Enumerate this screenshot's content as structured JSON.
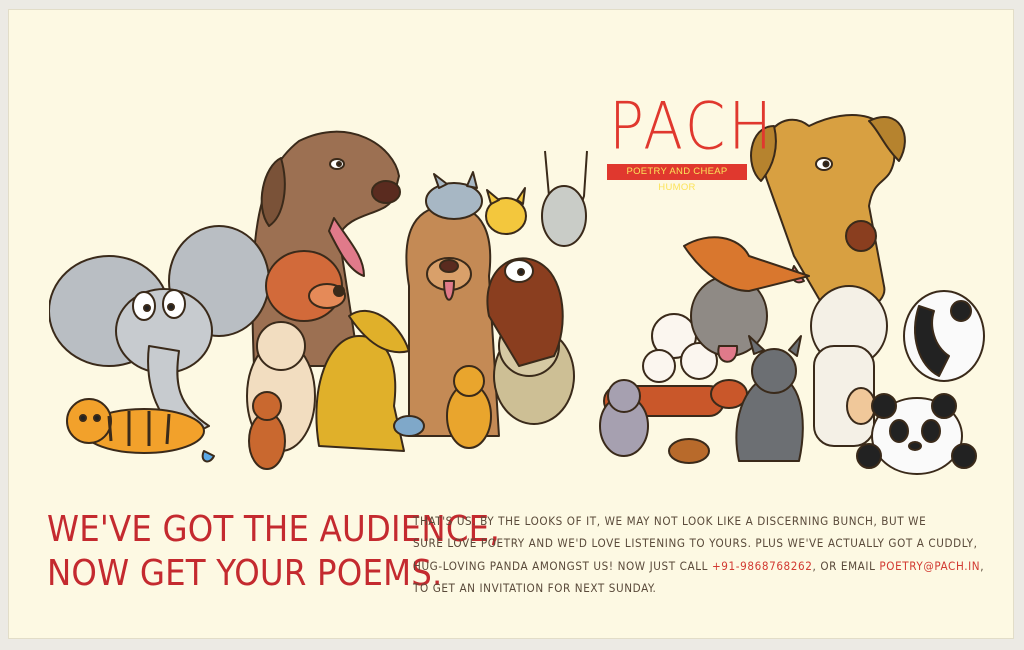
{
  "logo": {
    "name": "PACH",
    "tagline": "POETRY AND CHEAP HUMOR",
    "color": "#e0382e",
    "tagline_color": "#fbe35a"
  },
  "illustration": {
    "characters": [
      "elephant",
      "tiger",
      "great-dane",
      "basset-hound",
      "dachshund",
      "poodle",
      "sheepdog",
      "yellow-dog",
      "cats",
      "fox",
      "panda",
      "cow-dog"
    ]
  },
  "headline": {
    "line1": "WE'VE GOT THE AUDIENCE,",
    "line2": "NOW GET YOUR POEMS.",
    "color": "#c42a2f"
  },
  "body": {
    "line1": "THAT'S US. BY THE LOOKS OF IT, WE MAY NOT LOOK LIKE A DISCERNING BUNCH, BUT WE",
    "line2": "SURE LOVE POETRY AND WE'D LOVE LISTENING TO YOURS. PLUS WE'VE ACTUALLY GOT A CUDDLY,",
    "line3_pre": "HUG-LOVING PANDA AMONGST US! NOW JUST CALL ",
    "phone": "+91-9868768262",
    "line3_mid": ", OR EMAIL ",
    "email": "POETRY@PACH.IN",
    "line3_post": ",",
    "line4": "TO GET AN INVITATION FOR NEXT SUNDAY.",
    "highlight_color": "#d23a32"
  }
}
